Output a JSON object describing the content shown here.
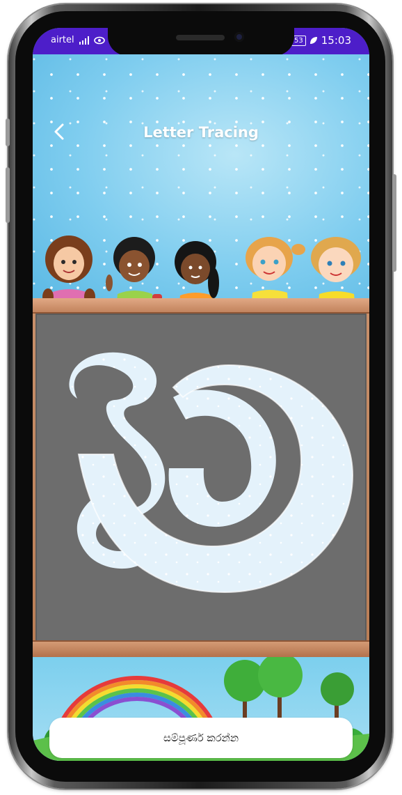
{
  "status_bar": {
    "carrier": "airtel",
    "battery": "53",
    "time": "15:03"
  },
  "header": {
    "title": "Letter Tracing",
    "back_icon": "chevron-left-icon"
  },
  "tracing": {
    "letter": "ක"
  },
  "footer": {
    "complete_label": "සම්පූර්ණ කරන්න"
  },
  "colors": {
    "status_bar": "#4d1ec9",
    "sky": "#7fcdef",
    "board": "#6d6d6d",
    "frame": "#c8906b",
    "letter_fill": "#e4f2fb"
  }
}
